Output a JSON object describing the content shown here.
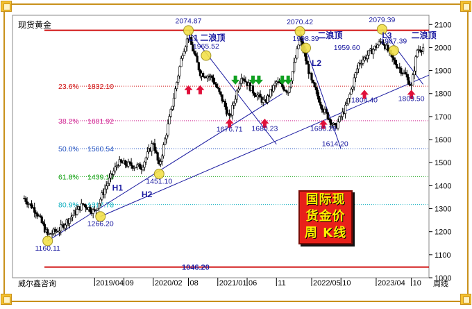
{
  "chart_data": {
    "type": "candlestick",
    "title": "现货黄金",
    "period_label": "周线",
    "source_label": "威尔鑫咨询",
    "ylim": [
      1000,
      2140
    ],
    "yticks": [
      1000,
      1100,
      1200,
      1300,
      1400,
      1500,
      1600,
      1700,
      1800,
      1900,
      2000,
      2100
    ],
    "x_range": [
      "2018-02",
      "2024-01"
    ],
    "x_tick_labels": [
      {
        "label": "2019/04",
        "date": "2019-04"
      },
      {
        "label": "09",
        "date": "2019-09"
      },
      {
        "label": "2020/02",
        "date": "2020-02"
      },
      {
        "label": "08",
        "date": "2020-08"
      },
      {
        "label": "2021/01",
        "date": "2021-01"
      },
      {
        "label": "06",
        "date": "2021-06"
      },
      {
        "label": "11",
        "date": "2021-11"
      },
      {
        "label": "2022/05",
        "date": "2022-05"
      },
      {
        "label": "10",
        "date": "2022-10"
      },
      {
        "label": "2023/04",
        "date": "2023-04"
      },
      {
        "label": "10",
        "date": "2023-10"
      }
    ],
    "price_path": [
      [
        "2018-04",
        1345
      ],
      [
        "2018-06",
        1290
      ],
      [
        "2018-08",
        1185
      ],
      [
        "2018-10",
        1210
      ],
      [
        "2018-12",
        1265
      ],
      [
        "2019-02",
        1320
      ],
      [
        "2019-04",
        1285
      ],
      [
        "2019-06",
        1400
      ],
      [
        "2019-08",
        1500
      ],
      [
        "2019-10",
        1490
      ],
      [
        "2019-12",
        1480
      ],
      [
        "2020-02",
        1590
      ],
      [
        "2020-03",
        1480
      ],
      [
        "2020-05",
        1720
      ],
      [
        "2020-07",
        1980
      ],
      [
        "2020-08",
        2050
      ],
      [
        "2020-10",
        1890
      ],
      [
        "2020-12",
        1870
      ],
      [
        "2021-02",
        1760
      ],
      [
        "2021-03",
        1690
      ],
      [
        "2021-05",
        1880
      ],
      [
        "2021-07",
        1810
      ],
      [
        "2021-09",
        1760
      ],
      [
        "2021-11",
        1850
      ],
      [
        "2022-01",
        1810
      ],
      [
        "2022-03",
        2040
      ],
      [
        "2022-05",
        1850
      ],
      [
        "2022-07",
        1730
      ],
      [
        "2022-09",
        1650
      ],
      [
        "2022-11",
        1750
      ],
      [
        "2023-01",
        1930
      ],
      [
        "2023-03",
        1980
      ],
      [
        "2023-05",
        2030
      ],
      [
        "2023-07",
        1940
      ],
      [
        "2023-09",
        1880
      ],
      [
        "2023-10",
        1830
      ],
      [
        "2023-11",
        1990
      ],
      [
        "2023-12",
        2000
      ]
    ],
    "horizontal_levels": [
      {
        "value": 2074.87,
        "color": "#d01010"
      },
      {
        "value": 1832.1,
        "color": "#d01010"
      },
      {
        "value": 1681.92,
        "color": "#d02090"
      },
      {
        "value": 1560.54,
        "color": "#2050c0"
      },
      {
        "value": 1439.16,
        "color": "#10a010"
      },
      {
        "value": 1317.78,
        "color": "#10b0c0"
      },
      {
        "value": 1046.2,
        "color": "#d01010"
      }
    ],
    "fibonacci": [
      {
        "pct": "23.6%",
        "value": "1832.10",
        "color": "#d01010"
      },
      {
        "pct": "38.2%",
        "value": "1681.92",
        "color": "#d02090"
      },
      {
        "pct": "50.0%",
        "value": "1560.54",
        "color": "#2050c0"
      },
      {
        "pct": "61.8%",
        "value": "1439.16",
        "color": "#10a010"
      },
      {
        "pct": "80.9%",
        "value": "1317.78",
        "color": "#10b0c0"
      }
    ],
    "bottom_level_label": "1046.20",
    "price_labels": [
      {
        "text": "2074.87",
        "date": "2020-08",
        "value": 2074.87
      },
      {
        "text": "1965.52",
        "date": "2020-11",
        "value": 1965.52
      },
      {
        "text": "2070.42",
        "date": "2022-03",
        "value": 2070.42
      },
      {
        "text": "1998.39",
        "date": "2022-04",
        "value": 1998.39
      },
      {
        "text": "2079.39",
        "date": "2023-05",
        "value": 2079.39
      },
      {
        "text": "1987.39",
        "date": "2023-07",
        "value": 1987.39
      },
      {
        "text": "1959.60",
        "date": "2022-11",
        "value": 1959.6
      },
      {
        "text": "1676.71",
        "date": "2021-03",
        "value": 1676.71
      },
      {
        "text": "1680.23",
        "date": "2021-09",
        "value": 1680.23
      },
      {
        "text": "1680.20",
        "date": "2022-07",
        "value": 1680.2
      },
      {
        "text": "1614.20",
        "date": "2022-09",
        "value": 1614.2
      },
      {
        "text": "1804.40",
        "date": "2023-02",
        "value": 1804.4
      },
      {
        "text": "1809.50",
        "date": "2023-10",
        "value": 1809.5
      },
      {
        "text": "1451.10",
        "date": "2020-03",
        "value": 1451.1
      },
      {
        "text": "1266.20",
        "date": "2019-05",
        "value": 1266.2
      },
      {
        "text": "1160.11",
        "date": "2018-08",
        "value": 1160.11
      }
    ],
    "trendlines": [
      {
        "name": "H1",
        "from": [
          "2018-08",
          1160.11
        ],
        "to": [
          "2021-12",
          1800
        ]
      },
      {
        "name": "H2",
        "from": [
          "2019-05",
          1266.2
        ],
        "to": [
          "2024-01",
          1880
        ]
      },
      {
        "name": "L1",
        "from": [
          "2020-08",
          2074.87
        ],
        "to": [
          "2021-11",
          1580
        ]
      },
      {
        "name": "L2",
        "from": [
          "2022-03",
          2070.42
        ],
        "to": [
          "2022-10",
          1560
        ]
      },
      {
        "name": "L3",
        "from": [
          "2023-05",
          2079.39
        ],
        "to": [
          "2023-12",
          1840
        ]
      }
    ],
    "trendline_labels": [
      {
        "text": "H1",
        "date": "2019-07",
        "value": 1378
      },
      {
        "text": "H2",
        "date": "2019-12",
        "value": 1350
      },
      {
        "text": "L1",
        "date": "2020-08",
        "value": 2030
      },
      {
        "text": "L2",
        "date": "2022-05",
        "value": 1920
      },
      {
        "text": "L3",
        "date": "2023-05",
        "value": 2040
      }
    ],
    "wave_labels": [
      {
        "text": "二浪顶",
        "date": "2020-10",
        "value": 2030
      },
      {
        "text": "二浪顶",
        "date": "2022-06",
        "value": 2040
      },
      {
        "text": "二浪顶",
        "date": "2023-10",
        "value": 2040
      }
    ],
    "markers": [
      {
        "kind": "circle",
        "date": "2018-08",
        "value": 1160
      },
      {
        "kind": "circle",
        "date": "2019-05",
        "value": 1266
      },
      {
        "kind": "circle",
        "date": "2020-03",
        "value": 1451
      },
      {
        "kind": "circle",
        "date": "2020-08",
        "value": 2074
      },
      {
        "kind": "circle",
        "date": "2020-11",
        "value": 1965
      },
      {
        "kind": "circle",
        "date": "2022-03",
        "value": 2070
      },
      {
        "kind": "circle",
        "date": "2022-04",
        "value": 1998
      },
      {
        "kind": "circle",
        "date": "2023-05",
        "value": 2079
      },
      {
        "kind": "circle",
        "date": "2023-07",
        "value": 1987
      },
      {
        "kind": "up-arrow",
        "color": "#e0103a",
        "date": "2020-08",
        "value": 1815
      },
      {
        "kind": "up-arrow",
        "color": "#e0103a",
        "date": "2020-10",
        "value": 1815
      },
      {
        "kind": "up-arrow",
        "color": "#e0103a",
        "date": "2021-03",
        "value": 1670
      },
      {
        "kind": "up-arrow",
        "color": "#e0103a",
        "date": "2021-09",
        "value": 1670
      },
      {
        "kind": "up-arrow",
        "color": "#e0103a",
        "date": "2022-07",
        "value": 1665
      },
      {
        "kind": "up-arrow",
        "color": "#e0103a",
        "date": "2023-02",
        "value": 1795
      },
      {
        "kind": "up-arrow",
        "color": "#e0103a",
        "date": "2023-10",
        "value": 1795
      },
      {
        "kind": "down-arrow",
        "color": "#10a020",
        "date": "2021-04",
        "value": 1860
      },
      {
        "kind": "down-arrow",
        "color": "#10a020",
        "date": "2021-07",
        "value": 1860
      },
      {
        "kind": "down-arrow",
        "color": "#10a020",
        "date": "2021-08",
        "value": 1860
      },
      {
        "kind": "down-arrow",
        "color": "#10a020",
        "date": "2021-12",
        "value": 1860
      },
      {
        "kind": "down-arrow",
        "color": "#10a020",
        "date": "2022-01",
        "value": 1860
      }
    ],
    "stamp_text": [
      "国际现",
      "货金价",
      "周 K线"
    ],
    "grid": false,
    "colors": {
      "up": "#000000",
      "down": "#000000",
      "trendline": "#1a1aa0",
      "label": "#1a1aa0"
    }
  }
}
